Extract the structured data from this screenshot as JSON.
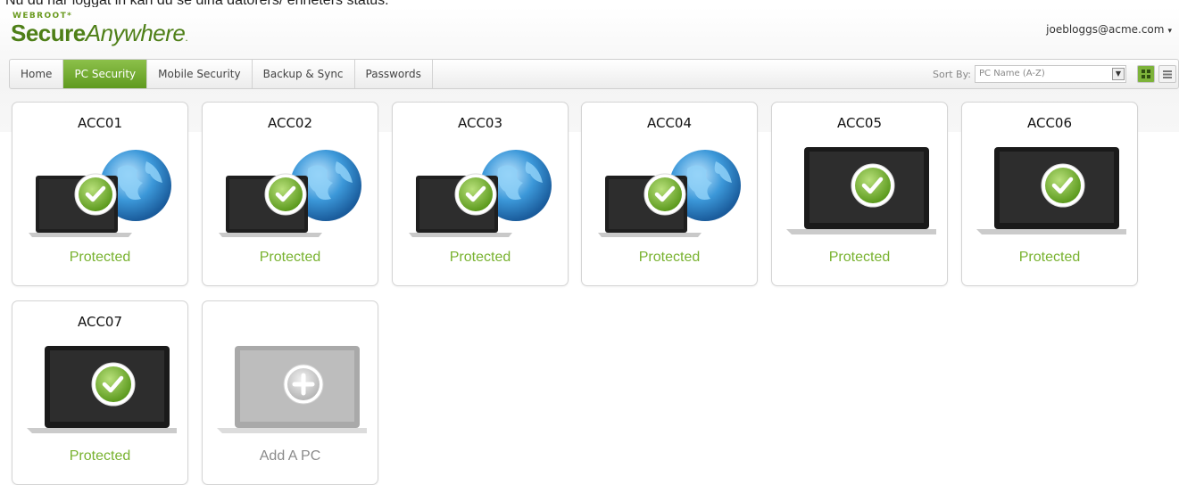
{
  "caption": "Nu du har loggat in kan du se dina datorers/ enheters status.",
  "brand": {
    "top": "WEBROOT",
    "secure": "Secure",
    "anywhere": "Anywhere",
    "tm": "."
  },
  "account": {
    "email": "joebloggs@acme.com",
    "caret": "▾"
  },
  "nav": {
    "tabs": [
      {
        "label": "Home"
      },
      {
        "label": "PC Security"
      },
      {
        "label": "Mobile Security"
      },
      {
        "label": "Backup & Sync"
      },
      {
        "label": "Passwords"
      }
    ],
    "active_tab": "PC Security"
  },
  "sort": {
    "label": "Sort By:",
    "value": "PC Name (A-Z)"
  },
  "devices": [
    {
      "name": "ACC01",
      "status": "Protected",
      "icon": "laptop-globe-check-icon"
    },
    {
      "name": "ACC02",
      "status": "Protected",
      "icon": "laptop-globe-check-icon"
    },
    {
      "name": "ACC03",
      "status": "Protected",
      "icon": "laptop-globe-check-icon"
    },
    {
      "name": "ACC04",
      "status": "Protected",
      "icon": "laptop-globe-check-icon"
    },
    {
      "name": "ACC05",
      "status": "Protected",
      "icon": "laptop-check-icon"
    },
    {
      "name": "ACC06",
      "status": "Protected",
      "icon": "laptop-check-icon"
    },
    {
      "name": "ACC07",
      "status": "Protected",
      "icon": "laptop-check-icon"
    }
  ],
  "add_pc": {
    "label": "Add A PC",
    "icon": "laptop-add-icon"
  },
  "colors": {
    "accent_green": "#78b22f",
    "tab_active": "#6fa82a",
    "globe_blue": "#2b86c9"
  }
}
